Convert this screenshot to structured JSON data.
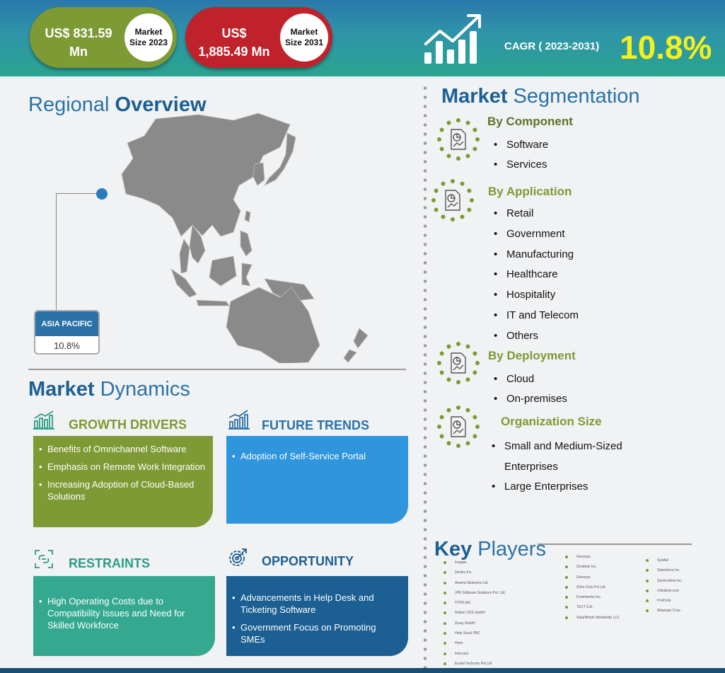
{
  "header": {
    "market_2023": {
      "value": "US$ 831.59 Mn",
      "label": "Market Size 2023"
    },
    "market_2031": {
      "value": "US$ 1,885.49 Mn",
      "label": "Market Size 2031"
    },
    "cagr_label": "CAGR ( 2023-2031)",
    "cagr_value": "10.8%"
  },
  "regional": {
    "title_light": "Regional",
    "title_bold": "Overview",
    "region_name": "ASIA PACIFIC",
    "region_value": "10.8%"
  },
  "dynamics": {
    "title_bold": "Market",
    "title_light": "Dynamics",
    "growth_drivers": {
      "heading": "GROWTH DRIVERS",
      "items": [
        "Benefits of Omnichannel Software",
        "Emphasis on Remote Work Integration",
        "Increasing Adoption of Cloud-Based Solutions"
      ]
    },
    "future_trends": {
      "heading": "FUTURE TRENDS",
      "items": [
        "Adoption of Self-Service Portal"
      ]
    },
    "restraints": {
      "heading": "RESTRAINTS",
      "items": [
        "High Operating Costs due to Compatibility  Issues and Need for Skilled Workforce"
      ]
    },
    "opportunity": {
      "heading": "OPPORTUNITY",
      "items": [
        "Advancements in Help Desk and Ticketing Software",
        "Government Focus on Promoting SMEs"
      ]
    }
  },
  "segmentation": {
    "title_bold": "Market",
    "title_light": "Segmentation",
    "component": {
      "heading": "By Component",
      "items": [
        "Software",
        " Services"
      ]
    },
    "application": {
      "heading": "By Application",
      "items": [
        "Retail",
        "Government",
        "Manufacturing",
        "Healthcare",
        "Hospitality",
        "IT and Telecom",
        "Others"
      ]
    },
    "deployment": {
      "heading": "By Deployment",
      "items": [
        "Cloud",
        "On-premises"
      ]
    },
    "org_size": {
      "heading": "Organization Size",
      "items": [
        "Small and Medium-Sized Enterprises",
        "Large Enterprises"
      ]
    }
  },
  "key_players": {
    "title_bold": "Key",
    "title_light": "Players",
    "col1": [
      "Invgate",
      "Deskiu Inc.",
      "Ameria Networks Ltd.",
      "JPK Software Solutions Pvt. Ltd.",
      "OTRS AG",
      "Rother OSS GmbH",
      "Zoury GmbH",
      "Help Scout PBC",
      "Hiver",
      "Intercom",
      "Exotel Techcom Pvt Ltd"
    ],
    "col2": [
      "Genesys",
      "Zendesk Inc.",
      "Genesys",
      "Zoho Corp Pvt Ltd",
      "Freshworks Inc.",
      "TEXT S.A.",
      "SolarWinds Worldwide LLC"
    ],
    "col3": [
      "SysAid",
      "Salesforce Inc.",
      "ServiceNow Inc.",
      "clickdesk.com",
      "ProProfs",
      "Atlassian Corp."
    ]
  },
  "colors": {
    "green": "#7e9a34",
    "red": "#c0222c",
    "blue": "#2a72a8",
    "light_blue": "#2f95dd",
    "teal": "#34a990",
    "navy": "#1c5f92",
    "cagr_yellow": "#f5ef1d"
  },
  "icons": [
    "growth-chart-icon",
    "bar-chart-icon",
    "trend-chart-icon",
    "link-icon",
    "gear-target-icon",
    "document-chart-icon"
  ]
}
